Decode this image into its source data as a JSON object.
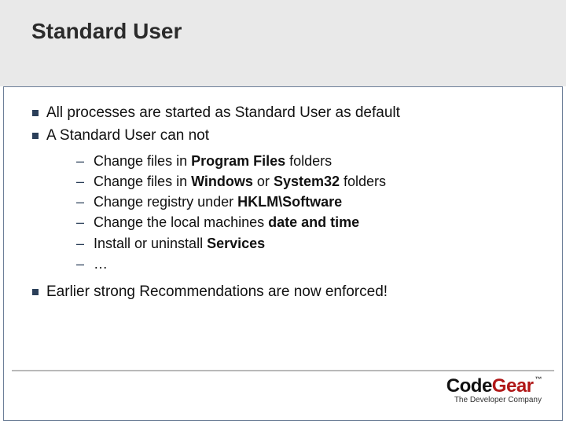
{
  "title": "Standard User",
  "bullets": {
    "b1": "All processes are started as Standard User as default",
    "b2": "A Standard User can not",
    "b3": "Earlier strong Recommendations are now enforced!"
  },
  "sub": {
    "s1_pre": "Change files in ",
    "s1_bold": "Program Files",
    "s1_post": " folders",
    "s2_pre": "Change files in ",
    "s2_bold1": "Windows",
    "s2_mid": " or ",
    "s2_bold2": "System32",
    "s2_post": " folders",
    "s3_pre": "Change registry under ",
    "s3_bold": "HKLM\\Software",
    "s4_pre": "Change the local machines ",
    "s4_bold": "date and time",
    "s5_pre": "Install or uninstall ",
    "s5_bold": "Services",
    "s6": "…"
  },
  "logo": {
    "code": "Code",
    "gear": "Gear",
    "tm": "™",
    "tagline": "The Developer Company"
  }
}
